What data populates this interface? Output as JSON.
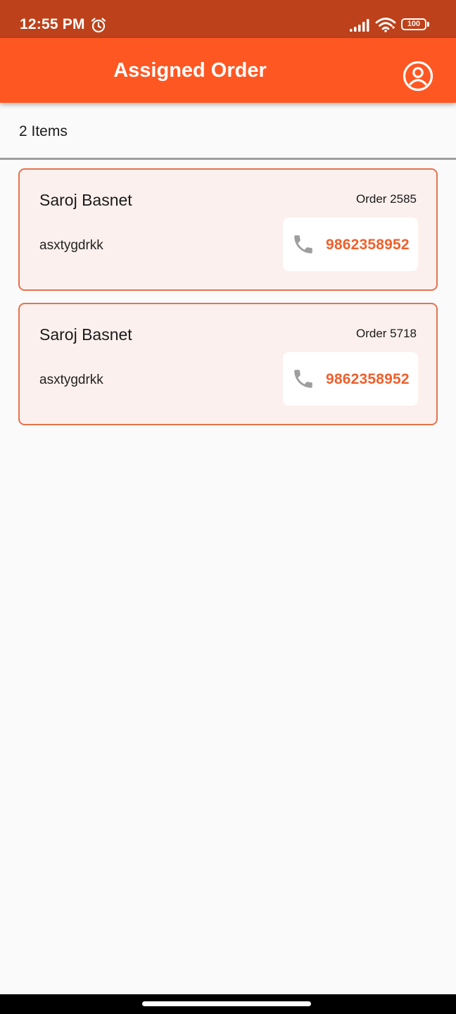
{
  "status_bar": {
    "time": "12:55 PM",
    "battery_level": "100",
    "icons": [
      "alarm-icon",
      "signal-icon",
      "wifi-icon",
      "battery-icon"
    ]
  },
  "app_bar": {
    "title": "Assigned Order",
    "action_icon": "account-circle-icon"
  },
  "list_header": {
    "count_label": "2 Items"
  },
  "orders": [
    {
      "name": "Saroj Basnet",
      "order_label": "Order 2585",
      "address": "asxtygdrkk",
      "phone": "9862358952",
      "phone_icon": "phone-icon"
    },
    {
      "name": "Saroj Basnet",
      "order_label": "Order 5718",
      "address": "asxtygdrkk",
      "phone": "9862358952",
      "phone_icon": "phone-icon"
    }
  ],
  "colors": {
    "status_bar": "#bd411a",
    "primary": "#ff5722",
    "card_border": "#e4734d",
    "card_background": "#fbf0ee",
    "phone_text": "#f0602c",
    "phone_icon": "#9e9e9e",
    "page_background": "#fafafa"
  }
}
